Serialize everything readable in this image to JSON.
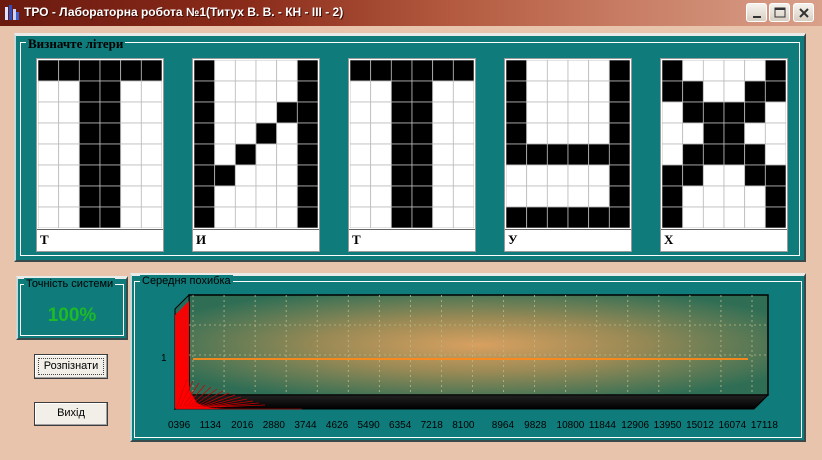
{
  "window": {
    "title": "ТРО - Лабораторна робота №1(Титух В. В. - КН - ІІІ - 2)",
    "icons": [
      "app-icon",
      "minimize-icon",
      "maximize-icon",
      "close-icon"
    ]
  },
  "letters_panel": {
    "legend": "Визначте літери",
    "letters": [
      {
        "label": "Т",
        "pattern": [
          "111111",
          "001100",
          "001100",
          "001100",
          "001100",
          "001100",
          "001100",
          "001100"
        ]
      },
      {
        "label": "И",
        "pattern": [
          "100001",
          "100001",
          "100011",
          "100101",
          "101001",
          "110001",
          "100001",
          "100001"
        ]
      },
      {
        "label": "Т",
        "pattern": [
          "111111",
          "001100",
          "001100",
          "001100",
          "001100",
          "001100",
          "001100",
          "001100"
        ]
      },
      {
        "label": "У",
        "pattern": [
          "100001",
          "100001",
          "100001",
          "100001",
          "111111",
          "000001",
          "000001",
          "111111"
        ]
      },
      {
        "label": "Х",
        "pattern": [
          "100001",
          "110011",
          "011110",
          "001100",
          "011110",
          "110011",
          "100001",
          "100001"
        ]
      }
    ]
  },
  "accuracy_panel": {
    "legend": "Точність системи",
    "value": "100%",
    "value_color": "#1dbb25"
  },
  "buttons": {
    "recognize": "Розпізнати",
    "exit": "Вихід"
  },
  "error_panel": {
    "legend": "Середня похибка"
  },
  "chart_data": {
    "type": "area",
    "title": "",
    "xlabel": "",
    "ylabel": "",
    "y_ticks": [
      "1"
    ],
    "x_ticks": [
      "0396",
      "1134",
      "2016",
      "2880",
      "3744",
      "4626",
      "5490",
      "6354",
      "7218",
      "8100",
      "8964",
      "9828",
      "10800",
      "11844",
      "12906",
      "13950",
      "15012",
      "16074",
      "17118"
    ],
    "series": [
      {
        "values": [
          1.6,
          0.9,
          0.3,
          0.1,
          0.05,
          0.02,
          0.01,
          0.0,
          0.0,
          0.0,
          0.0,
          0.0,
          0.0,
          0.0,
          0.0,
          0.0,
          0.0,
          0.0,
          0.0
        ],
        "color": "#ff0000"
      }
    ],
    "style": "3d",
    "grid": true
  }
}
